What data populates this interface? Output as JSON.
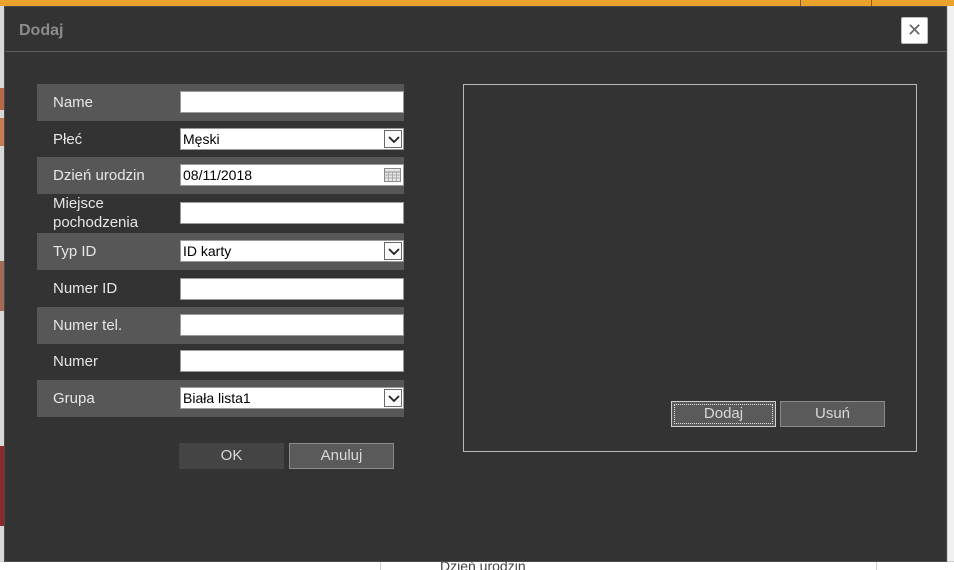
{
  "dialog": {
    "title": "Dodaj",
    "close_glyph": "✕"
  },
  "form": {
    "name": {
      "label": "Name",
      "value": ""
    },
    "gender": {
      "label": "Płeć",
      "value": "Męski"
    },
    "birthdate": {
      "label": "Dzień urodzin",
      "value": "08/11/2018"
    },
    "birthplace": {
      "label_line1": "Miejsce",
      "label_line2": "pochodzenia",
      "value": ""
    },
    "id_type": {
      "label": "Typ ID",
      "value": "ID karty"
    },
    "id_number": {
      "label": "Numer ID",
      "value": ""
    },
    "phone": {
      "label": "Numer tel.",
      "value": ""
    },
    "number": {
      "label": "Numer",
      "value": ""
    },
    "group": {
      "label": "Grupa",
      "value": "Biała lista1"
    }
  },
  "buttons": {
    "ok": "OK",
    "cancel": "Anuluj"
  },
  "photo": {
    "add": "Dodaj",
    "remove": "Usuń"
  },
  "background": {
    "ghost_text": "Dzień urodzin"
  },
  "icons": {
    "close": "close-icon",
    "dropdown": "chevron-down-icon",
    "calendar": "calendar-icon"
  },
  "colors": {
    "dialog_bg": "#333333",
    "row_shade": "#575757",
    "topbar": "#e9a32a"
  }
}
